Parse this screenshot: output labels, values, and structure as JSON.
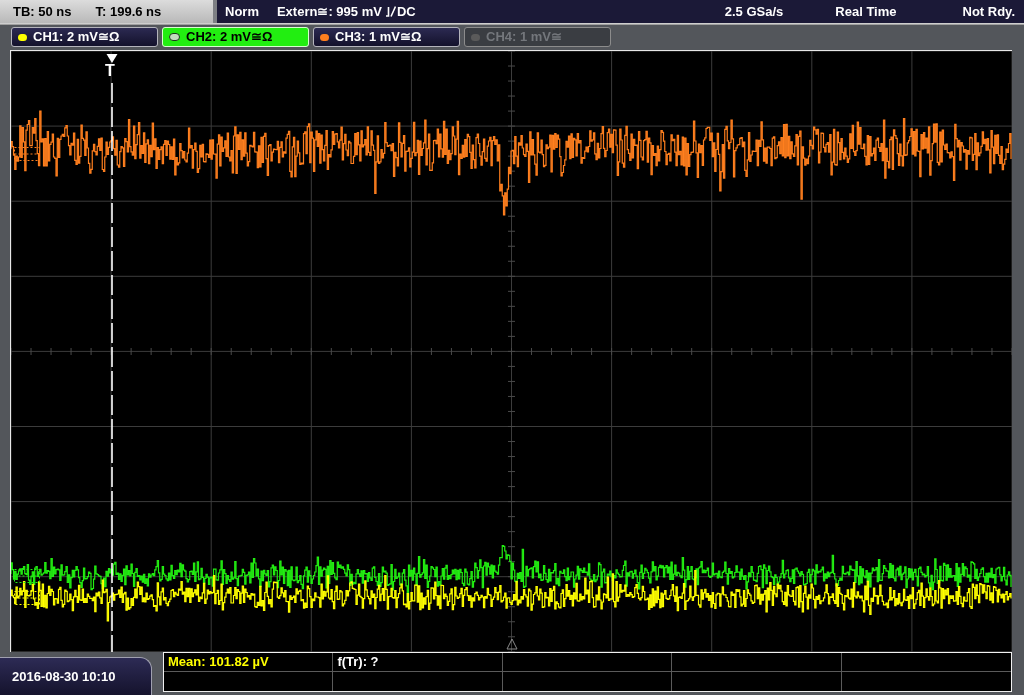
{
  "status_bar": {
    "timebase": "TB: 50 ns",
    "trigger_time": "T: 199.6 ns",
    "trigger_mode": "Norm",
    "trigger_source": "Extern≅: 995 mV",
    "trigger_coupling": "DC",
    "sample_rate": "2.5 GSa/s",
    "acquisition_mode": "Real Time",
    "acquisition_status": "Not Rdy."
  },
  "channels": [
    {
      "label": "CH1: 2 mV≅Ω",
      "color": "#ffff00",
      "selected": false,
      "active": true
    },
    {
      "label": "CH2: 2 mV≅Ω",
      "color": "#22ee11",
      "selected": true,
      "active": true
    },
    {
      "label": "CH3: 1 mV≅Ω",
      "color": "#ff7f1e",
      "selected": false,
      "active": true
    },
    {
      "label": "CH4: 1 mV≅",
      "color": "#5a5a5a",
      "selected": false,
      "active": false
    }
  ],
  "display": {
    "trigger_marker": "T"
  },
  "date_time": "2016-08-30 10:10",
  "measurements": [
    {
      "text": "Mean: 101.82 µV",
      "color": "#ffff00"
    },
    {
      "text": "f(Tr): ?",
      "color": "#ffffff"
    }
  ]
}
